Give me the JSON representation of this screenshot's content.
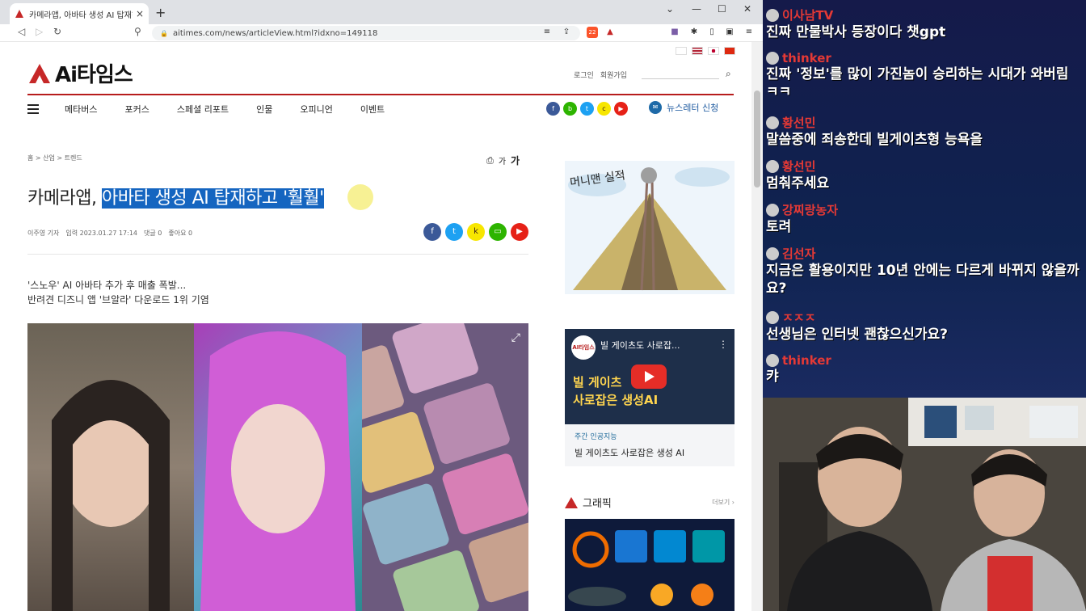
{
  "browser": {
    "tab_title": "카메라앱, 아바타 생성 AI 탑재하고",
    "tab_close": "×",
    "new_tab": "+",
    "url": "aitimes.com/news/articleView.html?idxno=149118",
    "ext_badge": "22"
  },
  "site": {
    "logo_text": "Ai타임스",
    "top_links": [
      "로그인",
      "회원가입"
    ],
    "menu": [
      "메타버스",
      "포커스",
      "스페셜 리포트",
      "인물",
      "오피니언",
      "이벤트"
    ],
    "newsletter": "뉴스레터 신청",
    "breadcrumb": "홈 > 산업 > 트렌드",
    "font_small": "가",
    "font_large": "가"
  },
  "article": {
    "headline_plain": "카메라앱, ",
    "headline_selected": "아바타 생성 AI 탑재하고 '훨훨'",
    "author": "이주영 기자",
    "date": "입력 2023.01.27 17:14",
    "comments": "댓글 0",
    "likes": "좋아요 0",
    "subhead_1": "'스노우' AI 아바타 추가 후 매출 폭발...",
    "subhead_2": "반려견 디즈니 앱 '브알라' 다운로드 1위 기염"
  },
  "sidebar": {
    "ad_label": "머니맨 실적",
    "video_title": "빌 게이츠도 사로잡...",
    "video_channel": "AI타임스",
    "video_big_1": "빌 게이츠",
    "video_big_2": "사로잡은 생성AI",
    "caption_channel": "주간 인공지능",
    "caption_title": "빌 게이츠도 사로잡은 생성 AI",
    "graphic_title": "그래픽",
    "graphic_more": "더보기 ›"
  },
  "chat": [
    {
      "name": "이사남TV",
      "color": "#e53935",
      "text": "진짜 만물박사 등장이다 챗gpt"
    },
    {
      "name": "thinker",
      "color": "#e53935",
      "text": "진짜 '정보'를 많이 가진놈이 승리하는 시대가 와버림 ㅋㅋ"
    },
    {
      "name": "황선민",
      "color": "#e53935",
      "text": "말씀중에 죄송한데 빌게이츠형 능욕을"
    },
    {
      "name": "황선민",
      "color": "#e53935",
      "text": "멈춰주세요"
    },
    {
      "name": "강찌랑농자",
      "color": "#e53935",
      "text": "토려"
    },
    {
      "name": "김선자",
      "color": "#e53935",
      "text": "지금은 활용이지만 10년 안에는 다르게 바뀌지 않을까요?"
    },
    {
      "name": "ㅈㅈㅈ",
      "color": "#e53935",
      "text": "선생님은 인터넷 괜찮으신가요?"
    },
    {
      "name": "thinker",
      "color": "#e53935",
      "text": "캬"
    }
  ],
  "colors": {
    "accent_red": "#b71c1c",
    "selection_blue": "#1565c0"
  }
}
